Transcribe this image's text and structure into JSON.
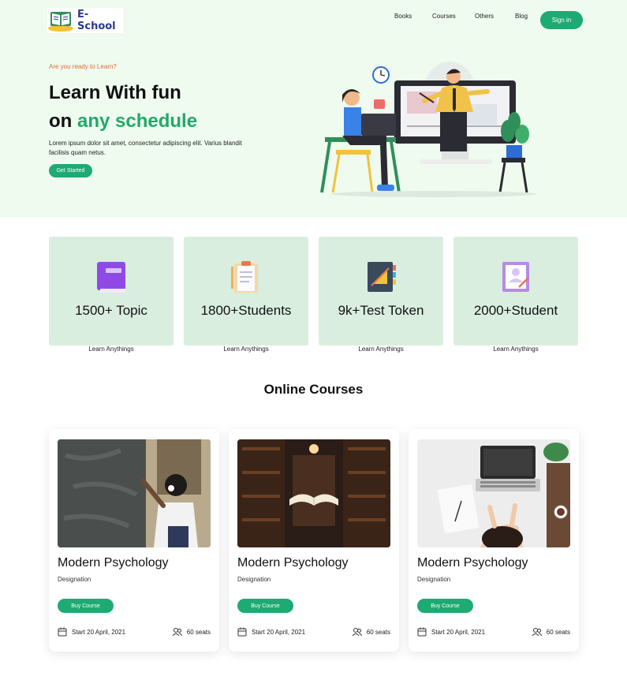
{
  "brand": {
    "name": "E- School"
  },
  "nav": {
    "items": [
      {
        "label": "Books"
      },
      {
        "label": "Courses"
      },
      {
        "label": "Others"
      },
      {
        "label": "Blog"
      }
    ],
    "signin_label": "Sign in"
  },
  "hero": {
    "eyebrow": "Are you ready to Learn?",
    "title_line1": "Learn With fun",
    "title_line2_prefix": "on ",
    "title_line2_accent": "any schedule",
    "description": "Lorem ipsum dolor sit amet, consectetur adipiscing elit. Varius blandit facilisis quam netus.",
    "cta_label": "Get Started"
  },
  "stats": [
    {
      "value": "1500+ Topic",
      "caption": "Learn Anythings",
      "icon": "book-icon"
    },
    {
      "value": "1800+Students",
      "caption": "Learn Anythings",
      "icon": "clipboard-icon"
    },
    {
      "value": "9k+Test Token",
      "caption": "Learn Anythings",
      "icon": "notebook-icon"
    },
    {
      "value": "2000+Student",
      "caption": "Learn Anythings",
      "icon": "certificate-icon"
    }
  ],
  "courses_section": {
    "title": "Online Courses"
  },
  "courses": [
    {
      "title": "Modern Psychology",
      "designation": "Designation",
      "buy_label": "Buy Course",
      "date": "Start 20 April, 2021",
      "seats": "60 seats",
      "image": "chalkboard-photo"
    },
    {
      "title": "Modern Psychology",
      "designation": "Designation",
      "buy_label": "Buy Course",
      "date": "Start 20 April, 2021",
      "seats": "60 seats",
      "image": "library-photo"
    },
    {
      "title": "Modern Psychology",
      "designation": "Designation",
      "buy_label": "Buy Course",
      "date": "Start 20 April, 2021",
      "seats": "60 seats",
      "image": "laptop-desk-photo"
    }
  ],
  "colors": {
    "accent": "#1eaa73",
    "hero_bg": "#eefbee",
    "stat_bg": "#d9eedf",
    "eyebrow": "#e06b3a",
    "brand_text": "#2c3a8c"
  }
}
